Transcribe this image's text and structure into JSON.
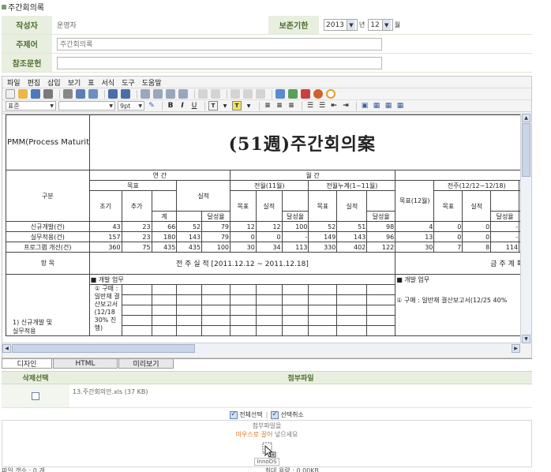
{
  "window": {
    "title": "주간회의록"
  },
  "form": {
    "author_label": "작성자",
    "author_value": "운영자",
    "retention_label": "보존기한",
    "year_value": "2013",
    "year_unit": "년",
    "month_value": "12",
    "month_unit": "월",
    "subject_label": "주제어",
    "subject_value": "주간회의록",
    "reference_label": "참조문헌",
    "reference_value": ""
  },
  "editor": {
    "menus": [
      "파일",
      "편집",
      "삽입",
      "보기",
      "표",
      "서식",
      "도구",
      "도움말"
    ],
    "style_value": "표준",
    "font_value": "",
    "size_value": "9pt",
    "bold": "B",
    "italic": "I",
    "underline": "U"
  },
  "document": {
    "title": "(51週)주간회의案",
    "org": "PMM(Process Maturity Management)실천",
    "col_gubun": "구분",
    "col_yeongan": "연 간",
    "col_wolgan": "월 간",
    "col_mokpyo": "목표",
    "col_silijeok": "실적",
    "col_chogi": "초기",
    "col_chuga": "추가",
    "col_gye": "계",
    "col_dalseong": "달성율",
    "col_jeonwol": "전월(11월)",
    "col_nugye": "전월누계(1~11월)",
    "col_mokpyo12": "목표(12월)",
    "col_jeonju": "전주(12/12~12/18)",
    "rows": [
      {
        "name": "신규개발(건)",
        "v": [
          "43",
          "23",
          "66",
          "52",
          "79",
          "12",
          "12",
          "100",
          "52",
          "51",
          "98",
          "4",
          "0",
          "0",
          "-"
        ]
      },
      {
        "name": "실무적용(건)",
        "v": [
          "157",
          "23",
          "180",
          "143",
          "79",
          "0",
          "0",
          "-",
          "149",
          "143",
          "96",
          "13",
          "0",
          "0",
          "-"
        ]
      },
      {
        "name": "프로그램 개선(건)",
        "v": [
          "360",
          "75",
          "435",
          "435",
          "100",
          "30",
          "34",
          "113",
          "330",
          "402",
          "122",
          "30",
          "7",
          "8",
          "114"
        ]
      }
    ],
    "hangmok": "항 목",
    "weekly_result": "전 주 실 적 [2011.12.12 ~ 2011.12.18]",
    "weekly_plan": "금 주 계 획",
    "dev_task": "■ 개발 업무",
    "dev_task2": "■ 개발 업무",
    "item1_a": "① 구매 :",
    "item1_b": "일반재 결",
    "item1_c": "산보고서",
    "item1_d": "(12/18",
    "item1_e": "30% 진행)",
    "item_right": "① 구매 : 일반재 결산보고서(12/25 40%",
    "section_label_a": "1) 신규개발 및",
    "section_label_b": "실무적용"
  },
  "tabs": [
    "디자인",
    "HTML",
    "미리보기"
  ],
  "attachments": {
    "col_delete": "삭제선택",
    "col_file": "첨부파일",
    "file_name": "13.주간회의안.xls",
    "file_size": "(37 KB)",
    "select_all": "전체선택",
    "separator": "|",
    "deselect": "선택취소",
    "drop_line1": "첨부파일을",
    "drop_highlight": "마우스로 끌어",
    "drop_line2": "넣으세요",
    "drop_brand": "InnoDS",
    "status_left": "파일 갯수 : 0 개",
    "status_right": "최대 용량 : 0.00KB"
  }
}
